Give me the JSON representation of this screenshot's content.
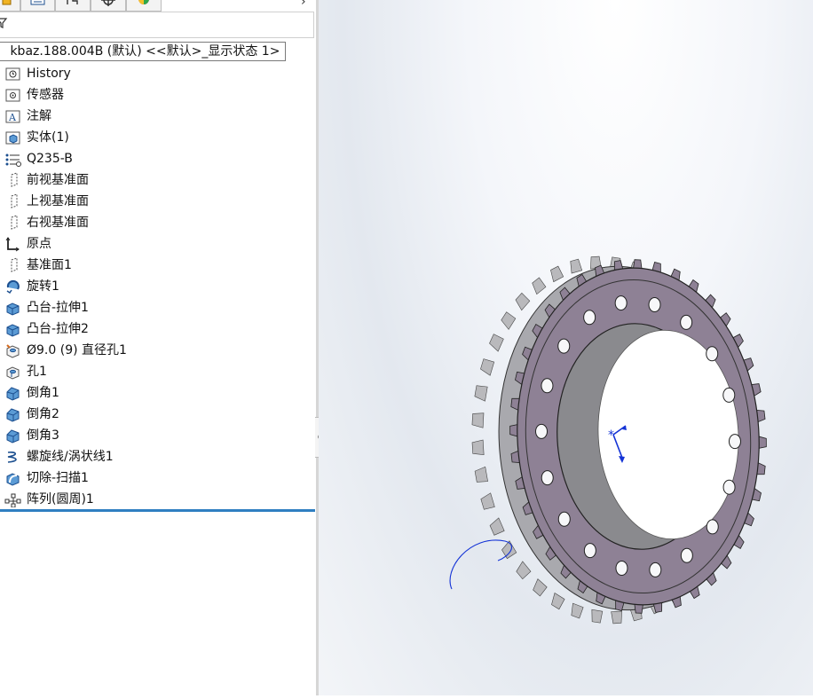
{
  "tree": {
    "root_label": "kbaz.188.004B (默认) <<默认>_显示状态 1>",
    "items": [
      {
        "label": "History",
        "icon": "history-icon"
      },
      {
        "label": "传感器",
        "icon": "sensor-icon"
      },
      {
        "label": "注解",
        "icon": "annotation-icon"
      },
      {
        "label": "实体(1)",
        "icon": "solid-bodies-icon"
      },
      {
        "label": "Q235-B",
        "icon": "material-icon"
      },
      {
        "label": "前视基准面",
        "icon": "plane-icon"
      },
      {
        "label": "上视基准面",
        "icon": "plane-icon"
      },
      {
        "label": "右视基准面",
        "icon": "plane-icon"
      },
      {
        "label": "原点",
        "icon": "origin-icon"
      },
      {
        "label": "基准面1",
        "icon": "plane-icon"
      },
      {
        "label": "旋转1",
        "icon": "revolve-icon"
      },
      {
        "label": "凸台-拉伸1",
        "icon": "extrude-icon"
      },
      {
        "label": "凸台-拉伸2",
        "icon": "extrude-icon"
      },
      {
        "label": "Ø9.0 (9) 直径孔1",
        "icon": "hole-wizard-icon"
      },
      {
        "label": "孔1",
        "icon": "hole-icon"
      },
      {
        "label": "倒角1",
        "icon": "chamfer-icon"
      },
      {
        "label": "倒角2",
        "icon": "chamfer-icon"
      },
      {
        "label": "倒角3",
        "icon": "chamfer-icon"
      },
      {
        "label": "螺旋线/涡状线1",
        "icon": "helix-icon"
      },
      {
        "label": "切除-扫描1",
        "icon": "swept-cut-icon"
      },
      {
        "label": "阵列(圆周)1",
        "icon": "circular-pattern-icon"
      }
    ]
  },
  "colors": {
    "accent": "#2f7fc1",
    "face": "#8e8195",
    "teeth": "#c9c9cb",
    "axis": "#1433d6"
  },
  "model": {
    "hole_count": 18,
    "tooth_count": 40
  }
}
